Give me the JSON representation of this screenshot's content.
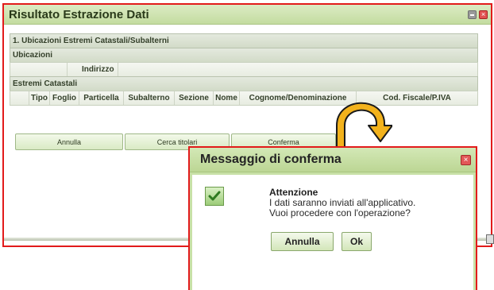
{
  "main_window": {
    "title": "Risultato Estrazione Dati",
    "section_1": "1. Ubicazioni Estremi Catastali/Subalterni",
    "ubicazioni": "Ubicazioni",
    "indirizzo": "Indirizzo",
    "estremi": "Estremi Catastali",
    "columns": [
      "Tipo",
      "Foglio",
      "Particella",
      "Subalterno",
      "Sezione",
      "Nome",
      "Cognome/Denominazione",
      "Cod. Fiscale/P.IVA"
    ],
    "buttons": {
      "annulla": "Annulla",
      "cerca": "Cerca titolari",
      "conferma": "Conferma"
    }
  },
  "dialog": {
    "title": "Messaggio di conferma",
    "heading": "Attenzione",
    "line1": "I dati saranno inviati all'applicativo.",
    "line2": "Vuoi procedere con l'operazione?",
    "annulla": "Annulla",
    "ok": "Ok"
  },
  "colors": {
    "highlight_border": "#e21b1b",
    "arrow_fill": "#f2b21c",
    "window_green": "#c8e0a6"
  },
  "icons": [
    "minimize-icon",
    "close-icon",
    "check-icon",
    "curved-arrow-icon"
  ]
}
